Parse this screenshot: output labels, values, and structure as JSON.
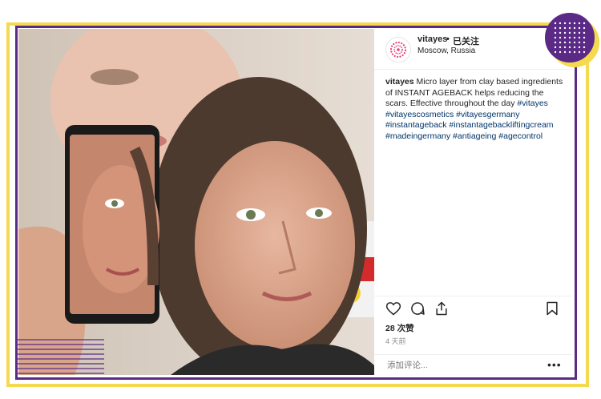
{
  "post": {
    "username": "vitayes",
    "separator": "•",
    "follow_label": "已关注",
    "location": "Moscow, Russia",
    "caption_user": "vitayes",
    "caption_text": " Micro layer from clay based ingredients of INSTANT AGEBACK helps reducing the scars. Effective throughout the day ",
    "hashtags": "#vitayes #vitayescosmetics #vitayesgermany #instantageback #instantagebackliftingcream #madeingermany #antiageing #agecontrol",
    "likes": "28 次赞",
    "time_ago": "4 天前",
    "comment_placeholder": "添加评论...",
    "more_label": "•••"
  },
  "colors": {
    "frame_yellow": "#f5d94e",
    "frame_purple": "#5a2a86",
    "hashtag_blue": "#003569",
    "avatar_pink": "#e8427c"
  },
  "icons": {
    "like": "heart-icon",
    "comment": "comment-icon",
    "share": "share-icon",
    "save": "bookmark-icon"
  }
}
